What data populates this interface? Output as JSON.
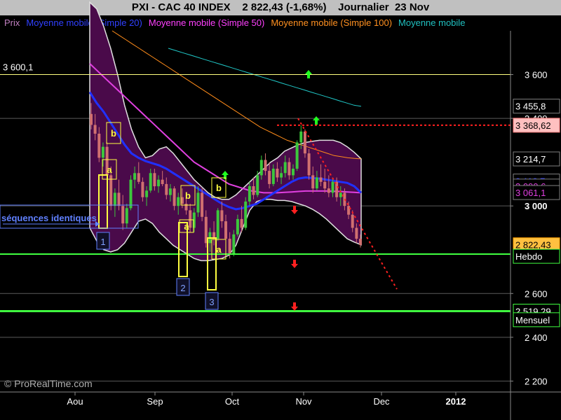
{
  "header": {
    "instrument": "PXI - CAC 40 INDEX",
    "price": "2 822,43 (-1,68%)",
    "period": "Journalier  23 Nov"
  },
  "legend": [
    {
      "label": "Prix",
      "color": "#c080c0"
    },
    {
      "label": "Moyenne mobile (Simple 20)",
      "color": "#3040ff"
    },
    {
      "label": "Moyenne mobile (Simple 50)",
      "color": "#ff40ff"
    },
    {
      "label": "Moyenne mobile (Simple 100)",
      "color": "#ff9020"
    },
    {
      "label": "Moyenne mobile",
      "color": "#20c0c0"
    }
  ],
  "watermark": "© ProRealTime.com",
  "colors": {
    "band_fill": "#4a0a4a",
    "candle_up": "#3cc83c",
    "candle_down": "#d07070",
    "ma20": "#2030ff",
    "ma50": "#e040e0",
    "ma100": "#ff8c1a",
    "ma200": "#20c8c8",
    "support": "#40ff40",
    "resistance": "#ffff80",
    "dotted_red": "#ff2020"
  },
  "chart_data": {
    "type": "candlestick",
    "ylim": [
      2150,
      3800
    ],
    "y_ticks": [
      {
        "value": 3600,
        "label": "3 600"
      },
      {
        "value": 3400,
        "label": "3 400"
      },
      {
        "value": 3000,
        "label": "3 000"
      },
      {
        "value": 2600,
        "label": "2 600"
      },
      {
        "value": 2400,
        "label": "2 400"
      },
      {
        "value": 2200,
        "label": "2 200"
      }
    ],
    "x_ticks": [
      {
        "label": "Aou",
        "bold": false
      },
      {
        "label": "Sep",
        "bold": false
      },
      {
        "label": "Oct",
        "bold": false
      },
      {
        "label": "Nov",
        "bold": false
      },
      {
        "label": "Dec",
        "bold": false
      },
      {
        "label": "2012",
        "bold": true
      }
    ],
    "boxes": [
      {
        "text": "3 455,8",
        "value": 3455.8,
        "bg": "#000",
        "fg": "#fff",
        "border": "#808080"
      },
      {
        "text": "3 368,62",
        "value": 3368.62,
        "bg": "#ffc0c0",
        "fg": "#000",
        "border": "#ff8080"
      },
      {
        "text": "3 214,7",
        "value": 3214.7,
        "bg": "#000",
        "fg": "#fff",
        "border": "#808080"
      },
      {
        "text": "3 113,7",
        "value": 3113.7,
        "bg": "#000",
        "fg": "#2030ff",
        "border": "#808080"
      },
      {
        "text": "3 090,6",
        "value": 3090.6,
        "bg": "#000",
        "fg": "#e040e0",
        "border": "#808080"
      },
      {
        "text": "3 061,1",
        "value": 3061.1,
        "bg": "#000",
        "fg": "#e040e0",
        "border": "#808080"
      },
      {
        "text": "2 822,43",
        "value": 2822.43,
        "bg": "#ffc040",
        "fg": "#000",
        "border": "#ffa000"
      },
      {
        "text": "Hebdo",
        "value": 2770,
        "bg": "#000",
        "fg": "#fff",
        "border": "#40ff40"
      },
      {
        "text": "2 519,29",
        "value": 2519.29,
        "bg": "#000",
        "fg": "#fff",
        "border": "#40ff40"
      },
      {
        "text": "Mensuel",
        "value": 2480,
        "bg": "#000",
        "fg": "#fff",
        "border": "#40ff40"
      }
    ],
    "horizontal_levels": [
      {
        "value": 3600,
        "label": "3 600,1",
        "color": "#ffff80",
        "width": 1
      },
      {
        "value": 2780,
        "label": "",
        "color": "#40ff40",
        "width": 2
      },
      {
        "value": 2519.29,
        "label": "",
        "color": "#40ff40",
        "width": 3
      },
      {
        "value": 3368.62,
        "label": "",
        "color": "#ff2020",
        "width": 2,
        "dotted": true
      }
    ],
    "annotation_text": "séquences identiques",
    "sequence_labels": [
      "1",
      "2",
      "3"
    ],
    "wave_labels": [
      "a",
      "b"
    ],
    "candles": [
      {
        "o": 3420,
        "h": 3470,
        "l": 3350,
        "c": 3370
      },
      {
        "o": 3370,
        "h": 3420,
        "l": 3300,
        "c": 3330
      },
      {
        "o": 3330,
        "h": 3360,
        "l": 3200,
        "c": 3220
      },
      {
        "o": 3220,
        "h": 3290,
        "l": 3180,
        "c": 3270
      },
      {
        "o": 3270,
        "h": 3290,
        "l": 3120,
        "c": 3140
      },
      {
        "o": 3140,
        "h": 3180,
        "l": 2980,
        "c": 3000
      },
      {
        "o": 3000,
        "h": 3080,
        "l": 2950,
        "c": 3060
      },
      {
        "o": 3060,
        "h": 3120,
        "l": 2980,
        "c": 3000
      },
      {
        "o": 3000,
        "h": 3050,
        "l": 2890,
        "c": 2920
      },
      {
        "o": 2920,
        "h": 3010,
        "l": 2900,
        "c": 2990
      },
      {
        "o": 2990,
        "h": 3140,
        "l": 2980,
        "c": 3120
      },
      {
        "o": 3120,
        "h": 3180,
        "l": 3080,
        "c": 3150
      },
      {
        "o": 3150,
        "h": 3200,
        "l": 3100,
        "c": 3110
      },
      {
        "o": 3110,
        "h": 3130,
        "l": 3020,
        "c": 3040
      },
      {
        "o": 3040,
        "h": 3090,
        "l": 3000,
        "c": 3070
      },
      {
        "o": 3070,
        "h": 3170,
        "l": 3060,
        "c": 3150
      },
      {
        "o": 3150,
        "h": 3170,
        "l": 3070,
        "c": 3090
      },
      {
        "o": 3090,
        "h": 3140,
        "l": 3060,
        "c": 3120
      },
      {
        "o": 3120,
        "h": 3160,
        "l": 3090,
        "c": 3100
      },
      {
        "o": 3100,
        "h": 3130,
        "l": 3030,
        "c": 3050
      },
      {
        "o": 3050,
        "h": 3100,
        "l": 3020,
        "c": 3080
      },
      {
        "o": 3080,
        "h": 3090,
        "l": 2980,
        "c": 3000
      },
      {
        "o": 3000,
        "h": 3060,
        "l": 2960,
        "c": 3040
      },
      {
        "o": 3040,
        "h": 3080,
        "l": 2990,
        "c": 3010
      },
      {
        "o": 3010,
        "h": 3050,
        "l": 2960,
        "c": 2980
      },
      {
        "o": 2980,
        "h": 3010,
        "l": 2880,
        "c": 2900
      },
      {
        "o": 2900,
        "h": 2990,
        "l": 2880,
        "c": 2970
      },
      {
        "o": 2970,
        "h": 3090,
        "l": 2950,
        "c": 3060
      },
      {
        "o": 3060,
        "h": 3080,
        "l": 2930,
        "c": 2950
      },
      {
        "o": 2950,
        "h": 2980,
        "l": 2810,
        "c": 2830
      },
      {
        "o": 2830,
        "h": 2900,
        "l": 2790,
        "c": 2880
      },
      {
        "o": 2880,
        "h": 2930,
        "l": 2820,
        "c": 2850
      },
      {
        "o": 2850,
        "h": 2990,
        "l": 2840,
        "c": 2980
      },
      {
        "o": 2980,
        "h": 3020,
        "l": 2900,
        "c": 2930
      },
      {
        "o": 2930,
        "h": 2960,
        "l": 2830,
        "c": 2850
      },
      {
        "o": 2850,
        "h": 2880,
        "l": 2760,
        "c": 2780
      },
      {
        "o": 2780,
        "h": 2890,
        "l": 2770,
        "c": 2870
      },
      {
        "o": 2870,
        "h": 2960,
        "l": 2860,
        "c": 2940
      },
      {
        "o": 2940,
        "h": 3000,
        "l": 2880,
        "c": 2900
      },
      {
        "o": 2900,
        "h": 3040,
        "l": 2890,
        "c": 3020
      },
      {
        "o": 3020,
        "h": 3110,
        "l": 3000,
        "c": 3090
      },
      {
        "o": 3090,
        "h": 3130,
        "l": 3030,
        "c": 3050
      },
      {
        "o": 3050,
        "h": 3160,
        "l": 3040,
        "c": 3140
      },
      {
        "o": 3140,
        "h": 3230,
        "l": 3120,
        "c": 3210
      },
      {
        "o": 3210,
        "h": 3240,
        "l": 3140,
        "c": 3160
      },
      {
        "o": 3160,
        "h": 3200,
        "l": 3080,
        "c": 3100
      },
      {
        "o": 3100,
        "h": 3190,
        "l": 3090,
        "c": 3170
      },
      {
        "o": 3170,
        "h": 3200,
        "l": 3110,
        "c": 3130
      },
      {
        "o": 3130,
        "h": 3180,
        "l": 3100,
        "c": 3150
      },
      {
        "o": 3150,
        "h": 3230,
        "l": 3130,
        "c": 3200
      },
      {
        "o": 3200,
        "h": 3220,
        "l": 3120,
        "c": 3140
      },
      {
        "o": 3140,
        "h": 3190,
        "l": 3120,
        "c": 3170
      },
      {
        "o": 3170,
        "h": 3300,
        "l": 3160,
        "c": 3290
      },
      {
        "o": 3290,
        "h": 3368,
        "l": 3260,
        "c": 3340
      },
      {
        "o": 3340,
        "h": 3350,
        "l": 3220,
        "c": 3240
      },
      {
        "o": 3240,
        "h": 3260,
        "l": 3120,
        "c": 3140
      },
      {
        "o": 3140,
        "h": 3180,
        "l": 3060,
        "c": 3080
      },
      {
        "o": 3080,
        "h": 3160,
        "l": 3070,
        "c": 3130
      },
      {
        "o": 3130,
        "h": 3190,
        "l": 3090,
        "c": 3110
      },
      {
        "o": 3110,
        "h": 3170,
        "l": 3060,
        "c": 3080
      },
      {
        "o": 3080,
        "h": 3140,
        "l": 3040,
        "c": 3060
      },
      {
        "o": 3060,
        "h": 3130,
        "l": 3040,
        "c": 3110
      },
      {
        "o": 3110,
        "h": 3130,
        "l": 3020,
        "c": 3040
      },
      {
        "o": 3040,
        "h": 3090,
        "l": 3000,
        "c": 3060
      },
      {
        "o": 3060,
        "h": 3080,
        "l": 2980,
        "c": 3000
      },
      {
        "o": 3000,
        "h": 3020,
        "l": 2940,
        "c": 2960
      },
      {
        "o": 2960,
        "h": 2980,
        "l": 2880,
        "c": 2900
      },
      {
        "o": 2900,
        "h": 2920,
        "l": 2830,
        "c": 2850
      },
      {
        "o": 2850,
        "h": 2870,
        "l": 2810,
        "c": 2822
      }
    ],
    "bollinger_upper": [
      3930,
      3900,
      3820,
      3720,
      3600,
      3460,
      3350,
      3270,
      3220,
      3230,
      3260,
      3270,
      3240,
      3200,
      3160,
      3120,
      3090,
      3060,
      3040,
      3030,
      3030,
      3050,
      3080,
      3110,
      3140,
      3170,
      3200,
      3220,
      3250,
      3265,
      3280,
      3290,
      3295,
      3300,
      3300,
      3300,
      3290,
      3270,
      3245,
      3215
    ],
    "bollinger_lower": [
      2900,
      2840,
      2800,
      2790,
      2800,
      2830,
      2880,
      2930,
      2940,
      2920,
      2880,
      2850,
      2820,
      2800,
      2780,
      2760,
      2750,
      2750,
      2755,
      2760,
      2775,
      2820,
      2900,
      2980,
      3020,
      3030,
      3030,
      3025,
      3025,
      3020,
      3010,
      3000,
      2985,
      2965,
      2940,
      2910,
      2880,
      2850,
      2835,
      2822
    ],
    "ma20": [
      3520,
      3470,
      3430,
      3380,
      3330,
      3280,
      3240,
      3220,
      3205,
      3195,
      3185,
      3170,
      3150,
      3130,
      3110,
      3090,
      3070,
      3050,
      3030,
      3010,
      2995,
      2985,
      2990,
      3000,
      3010,
      3030,
      3050,
      3070,
      3090,
      3110,
      3125,
      3130,
      3128,
      3125,
      3120,
      3115,
      3110,
      3105,
      3090,
      3060
    ],
    "ma50": [
      3650,
      3620,
      3590,
      3560,
      3530,
      3500,
      3470,
      3440,
      3410,
      3380,
      3350,
      3320,
      3290,
      3260,
      3230,
      3200,
      3180,
      3160,
      3140,
      3120,
      3100,
      3090,
      3080,
      3070,
      3065,
      3060,
      3060,
      3060,
      3062,
      3064,
      3066,
      3068,
      3068,
      3068,
      3068,
      3067,
      3066,
      3064,
      3062,
      3060
    ],
    "ma100": [
      3800,
      3780,
      3760,
      3740,
      3720,
      3700,
      3680,
      3660,
      3640,
      3620,
      3600,
      3580,
      3560,
      3540,
      3520,
      3500,
      3480,
      3460,
      3440,
      3420,
      3400,
      3380,
      3360,
      3345,
      3330,
      3315,
      3300,
      3290,
      3280,
      3270,
      3260,
      3250,
      3240,
      3230,
      3225,
      3220,
      3217,
      3215
    ],
    "ma200": [
      3720,
      3710,
      3700,
      3690,
      3680,
      3670,
      3660,
      3650,
      3640,
      3630,
      3620,
      3610,
      3600,
      3590,
      3580,
      3570,
      3560,
      3550,
      3540,
      3530,
      3520,
      3510,
      3500,
      3490,
      3480,
      3470,
      3460,
      3455
    ]
  }
}
